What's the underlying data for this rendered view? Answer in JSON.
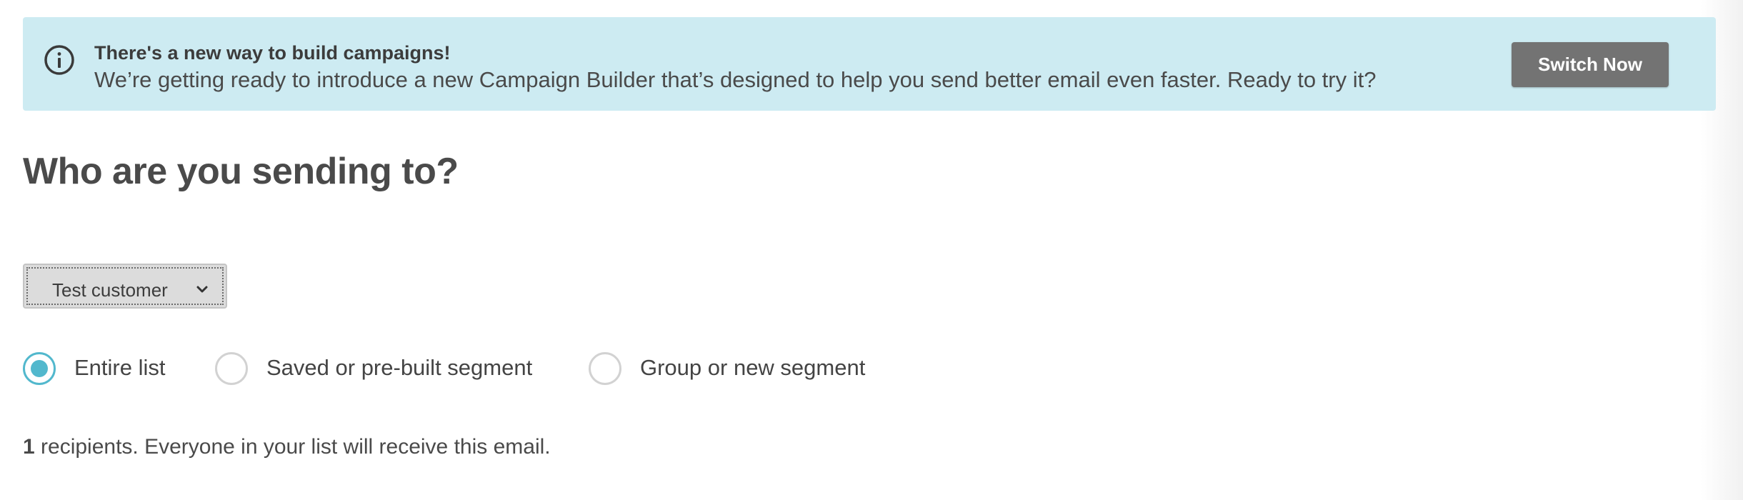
{
  "banner": {
    "icon": "info-icon",
    "title": "There's a new way to build campaigns!",
    "text": "We’re getting ready to introduce a new Campaign Builder that’s designed to help you send better email even faster. Ready to try it?",
    "button_label": "Switch Now",
    "background_color": "#cdebf2",
    "button_color": "#737373"
  },
  "page": {
    "title": "Who are you sending to?"
  },
  "list_select": {
    "selected": "Test customer",
    "icon": "chevron-down-icon"
  },
  "audience_options": [
    {
      "label": "Entire list",
      "checked": true
    },
    {
      "label": "Saved or pre-built segment",
      "checked": false
    },
    {
      "label": "Group or new segment",
      "checked": false
    }
  ],
  "recipients": {
    "count": "1",
    "text": " recipients. Everyone in your list will receive this email."
  },
  "colors": {
    "accent": "#52b8cd",
    "text": "#4a4a4a"
  }
}
